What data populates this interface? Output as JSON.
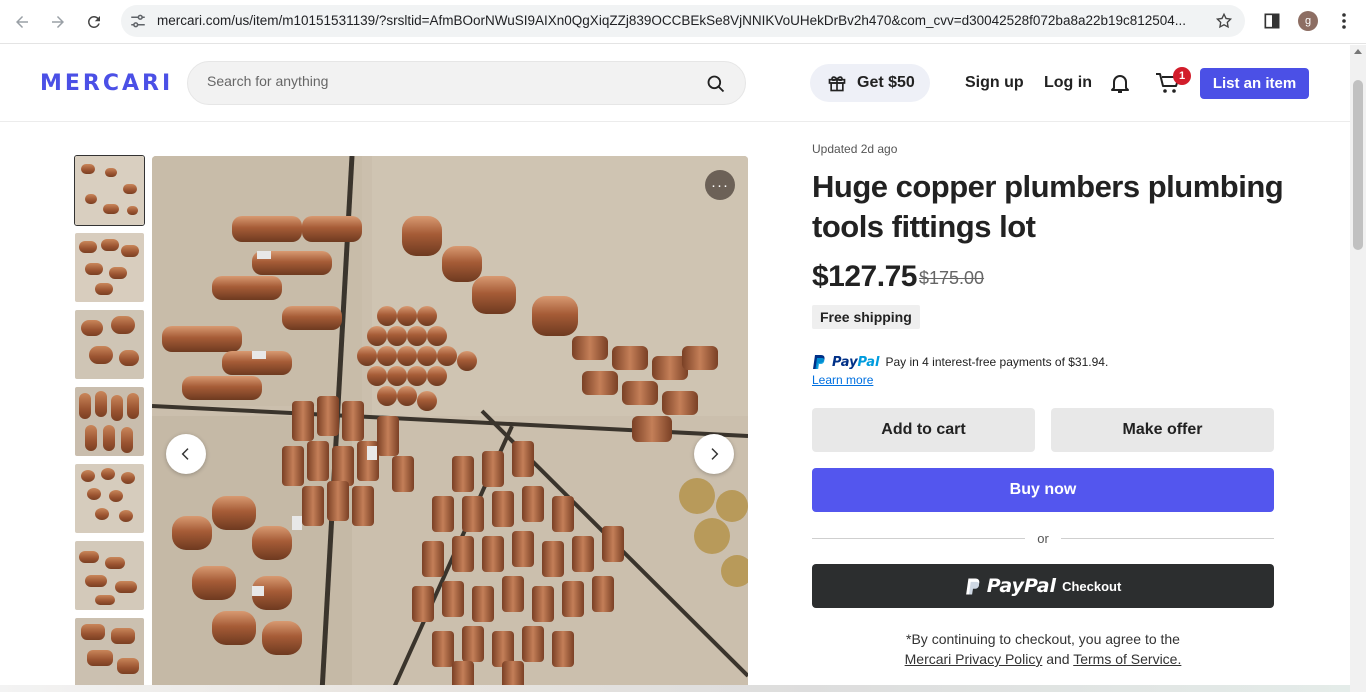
{
  "browser": {
    "url": "mercari.com/us/item/m10151531139/?srsltid=AfmBOorNWuSI9AIXn0QgXiqZZj839OCCBEkSe8VjNNIKVoUHekDrBv2h470&com_cvv=d30042528f072ba8a22b19c812504...",
    "profile_initial": "g"
  },
  "header": {
    "logo": "MERCARI",
    "search_placeholder": "Search for anything",
    "get_offer": "Get $50",
    "signup": "Sign up",
    "login": "Log in",
    "cart_count": "1",
    "list_item": "List an item"
  },
  "item": {
    "updated": "Updated 2d ago",
    "title": "Huge copper plumbers plumbing tools fittings lot",
    "price": "$127.75",
    "original_price": "$175.00",
    "shipping": "Free shipping",
    "paypal_brand_a": "Pay",
    "paypal_brand_b": "Pal",
    "paypal_text": "Pay in 4 interest-free payments of $31.94.",
    "learn_more": "Learn more",
    "add_to_cart": "Add to cart",
    "make_offer": "Make offer",
    "buy_now": "Buy now",
    "or": "or",
    "paypal_checkout_brand": "PayPal",
    "paypal_checkout_label": "Checkout",
    "disclaimer_prefix": "*By continuing to checkout, you agree to the",
    "privacy_link": "Mercari Privacy Policy",
    "and": "and",
    "terms_link": "Terms of Service."
  },
  "gallery": {
    "more_label": "···",
    "thumbnails": 7
  },
  "colors": {
    "brand": "#4b50e6",
    "buy_now": "#5356ee",
    "paypal_dark": "#2c2e2f",
    "badge_red": "#d21d2b"
  }
}
